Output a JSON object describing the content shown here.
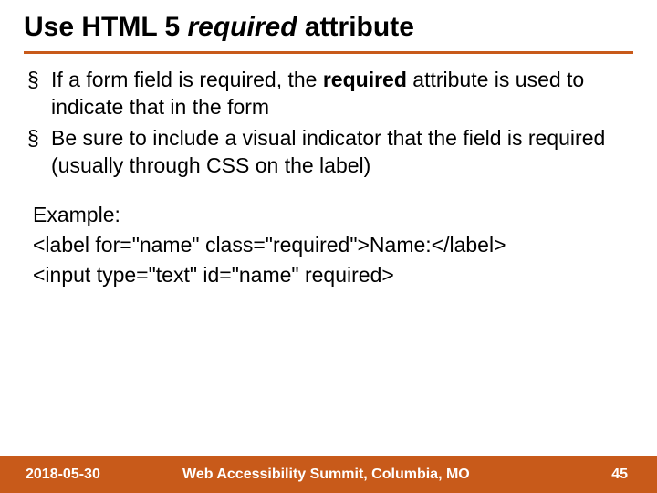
{
  "title": {
    "pre": "Use HTML 5 ",
    "ital": "required ",
    "post": "attribute"
  },
  "bullets": [
    {
      "pre": "If a form field is required, the ",
      "bold": "required",
      "post": " attribute is used to indicate that in the form"
    },
    {
      "pre": "Be sure to include a visual indicator that the field is required (usually through CSS on the label)",
      "bold": "",
      "post": ""
    }
  ],
  "example": {
    "label": "Example:",
    "line1": "<label for=\"name\" class=\"required\">Name:</label>",
    "line2": "<input type=\"text\" id=\"name\" required>"
  },
  "footer": {
    "date": "2018-05-30",
    "title": "Web Accessibility Summit, Columbia, MO",
    "page": "45"
  }
}
